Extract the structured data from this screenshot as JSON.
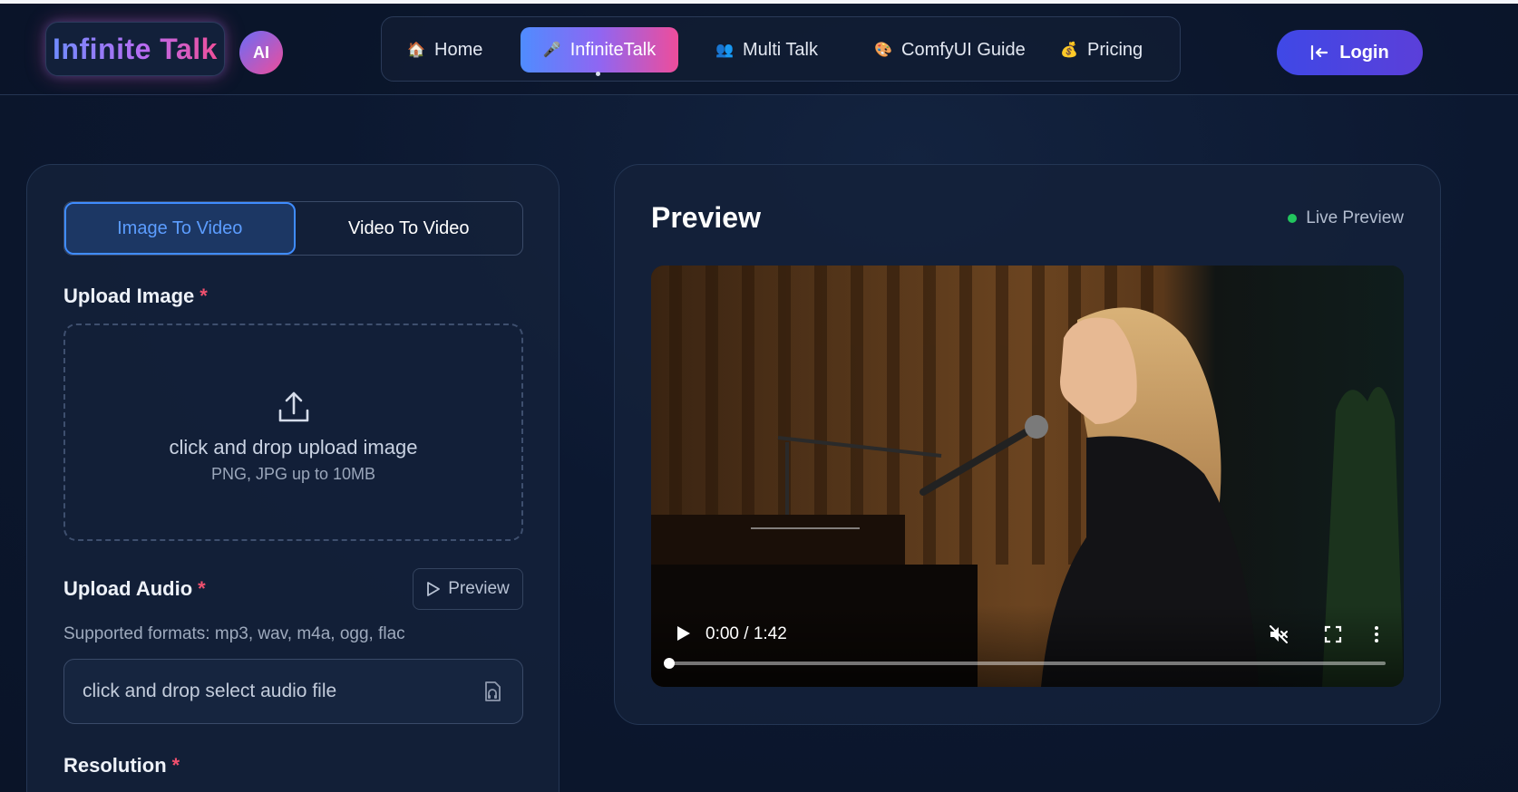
{
  "header": {
    "logo_text": "Infinite Talk",
    "ai_badge": "AI",
    "nav": [
      {
        "label": "Home",
        "icon": "house-icon",
        "glyph": "🏠",
        "active": false
      },
      {
        "label": "InfiniteTalk",
        "icon": "microphone-icon",
        "glyph": "🎤",
        "active": true
      },
      {
        "label": "Multi Talk",
        "icon": "people-icon",
        "glyph": "👥",
        "active": false
      },
      {
        "label": "ComfyUI Guide",
        "icon": "palette-icon",
        "glyph": "🎨",
        "active": false
      },
      {
        "label": "Pricing",
        "icon": "money-bag-icon",
        "glyph": "💰",
        "active": false
      }
    ],
    "login_label": "Login"
  },
  "form": {
    "tabs": [
      {
        "label": "Image To Video",
        "active": true
      },
      {
        "label": "Video To Video",
        "active": false
      }
    ],
    "upload_image_label": "Upload Image",
    "required_mark": "*",
    "dropzone_main": "click and drop upload image",
    "dropzone_sub": "PNG, JPG up to 10MB",
    "upload_audio_label": "Upload Audio",
    "preview_button": "Preview",
    "formats_text": "Supported formats: mp3, wav, m4a, ogg, flac",
    "audio_placeholder": "click and drop select audio file",
    "resolution_label": "Resolution"
  },
  "preview": {
    "title": "Preview",
    "live_label": "Live Preview",
    "video": {
      "time": "0:00 / 1:42",
      "progress": 0.0,
      "muted": true
    }
  },
  "colors": {
    "accent_blue": "#3f8cff",
    "accent_pink": "#ee4d9b",
    "required_red": "#f0506e",
    "live_green": "#22c55e",
    "login_indigo": "#3f48e6"
  }
}
